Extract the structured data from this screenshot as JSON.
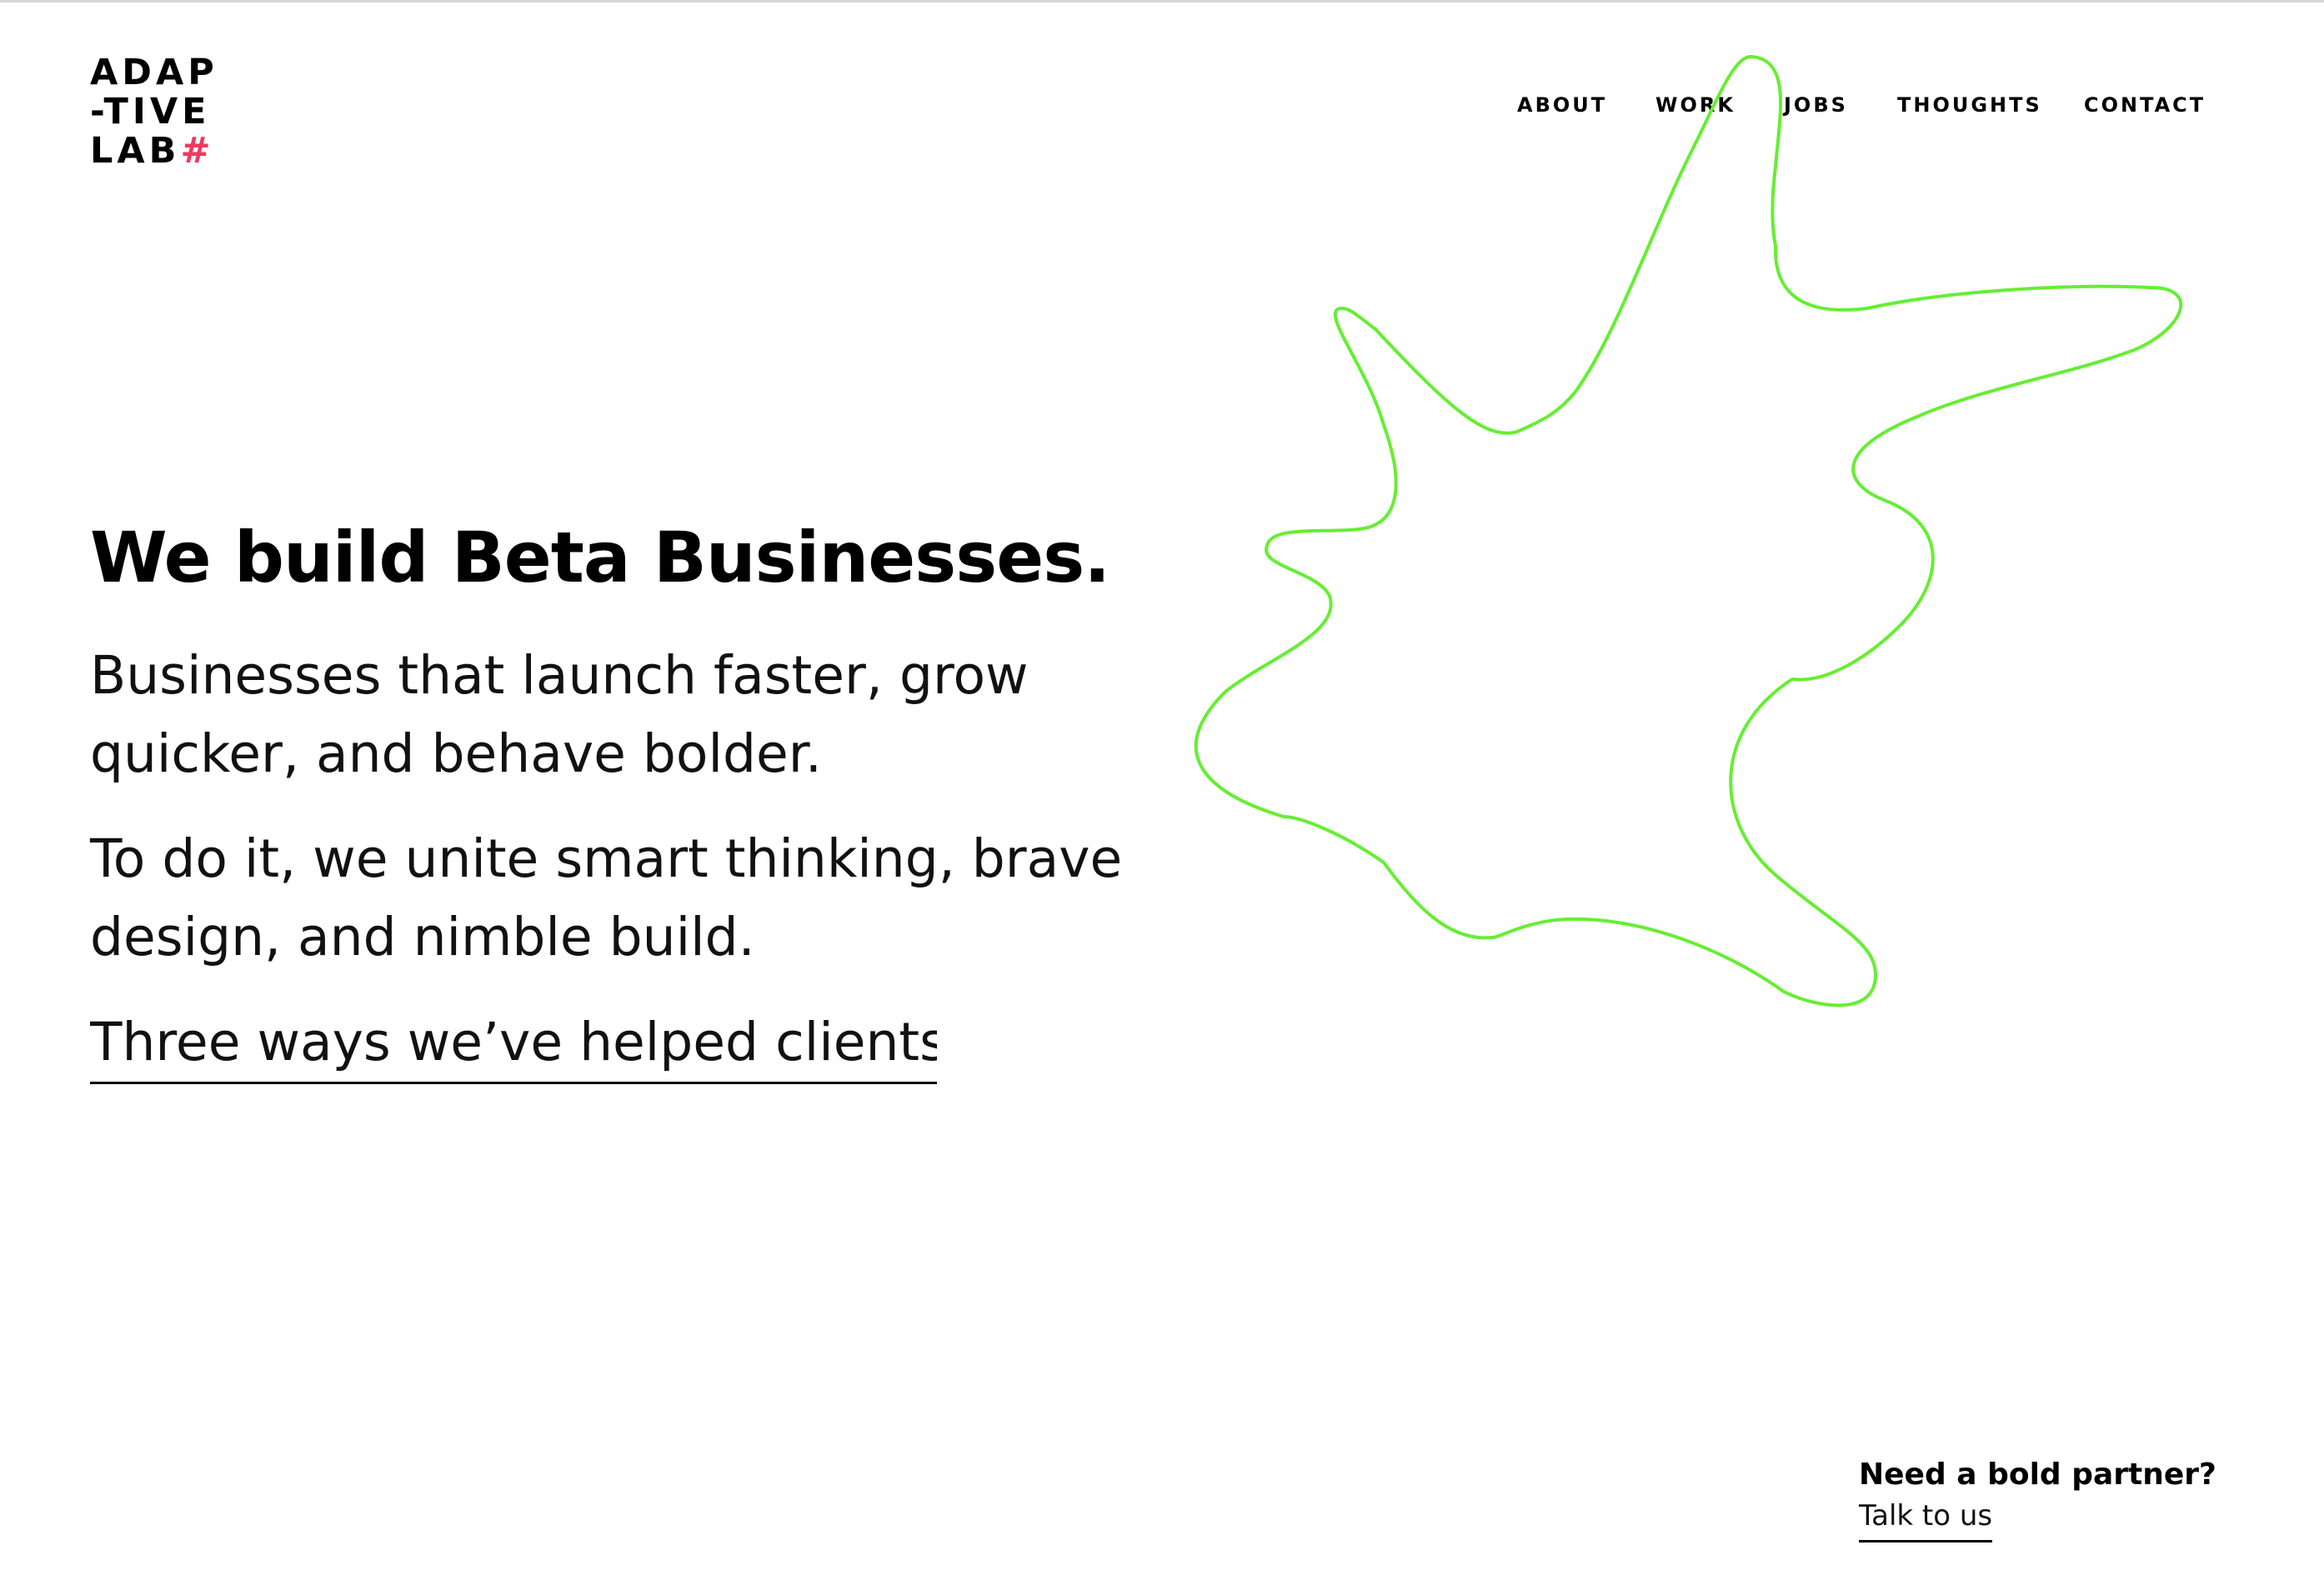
{
  "logo": {
    "line1": "ADAP",
    "line2": "-TIVE",
    "line3": "LAB",
    "hash": "#",
    "hash_color": "#ef3a5d"
  },
  "nav": {
    "items": [
      {
        "label": "ABOUT"
      },
      {
        "label": "WORK"
      },
      {
        "label": "JOBS"
      },
      {
        "label": "THOUGHTS"
      },
      {
        "label": "CONTACT"
      }
    ]
  },
  "hero": {
    "headline": "We build Beta Businesses.",
    "paragraph_1": "Businesses that launch faster, grow quicker, and behave bolder.",
    "paragraph_2": "To do it, we unite smart thinking, brave design, and nimble build.",
    "cta_link": "Three ways we’ve helped clients."
  },
  "blob": {
    "stroke_color": "#66ee33"
  },
  "footer_cta": {
    "title": "Need a bold partner?",
    "link": "Talk to us"
  }
}
